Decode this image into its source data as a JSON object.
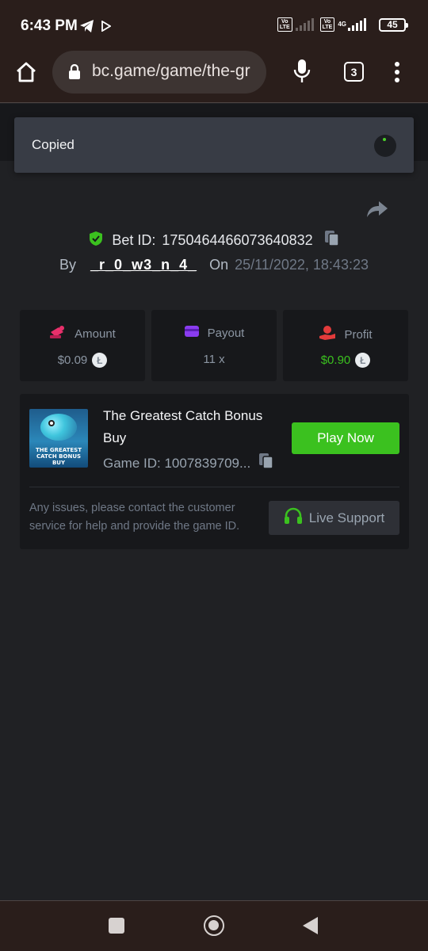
{
  "status_bar": {
    "time": "6:43 PM",
    "network": "4G",
    "volte1": "Vo\nLTE",
    "volte2": "Vo\nLTE",
    "battery": "45"
  },
  "browser": {
    "url": "bc.game/game/the-gr",
    "tab_count": "3"
  },
  "toast": {
    "text": "Copied"
  },
  "bet": {
    "bet_id_label": "Bet ID:",
    "bet_id": "1750464466073640832",
    "by_label": "By",
    "username": "_r_0_w3_n_4_",
    "on_label": "On",
    "date": "25/11/2022, 18:43:23"
  },
  "stats": {
    "amount_label": "Amount",
    "amount_value": "$0.09",
    "payout_label": "Payout",
    "payout_value": "11 x",
    "profit_label": "Profit",
    "profit_value": "$0.90"
  },
  "game": {
    "title": "The Greatest Catch Bonus Buy",
    "thumb_text": "THE GREATEST CATCH BONUS BUY",
    "game_id": "Game ID: 1007839709...",
    "play_label": "Play Now",
    "support_text": "Any issues, please contact the customer service for help and provide the game ID.",
    "live_support_label": "Live Support"
  },
  "colors": {
    "accent_green": "#3bc11f",
    "page_bg": "#202124",
    "card_bg": "#17181b",
    "amount_icon": "#e8306b",
    "payout_icon": "#8a3cf0",
    "profit_icon": "#e23b3b"
  }
}
